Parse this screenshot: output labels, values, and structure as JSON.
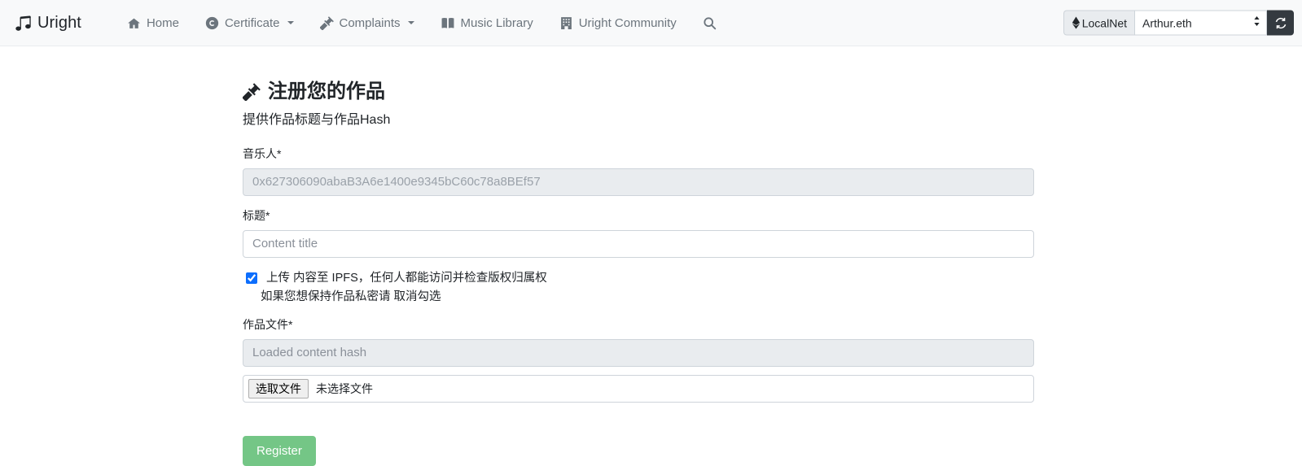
{
  "navbar": {
    "brand": {
      "label": "Uright",
      "icon": "music-note-icon"
    },
    "items": [
      {
        "label": "Home",
        "icon": "home-icon",
        "has_caret": false
      },
      {
        "label": "Certificate",
        "icon": "copyright-icon",
        "has_caret": true
      },
      {
        "label": "Complaints",
        "icon": "gavel-icon",
        "has_caret": true
      },
      {
        "label": "Music Library",
        "icon": "book-icon",
        "has_caret": false
      },
      {
        "label": "Uright Community",
        "icon": "building-icon",
        "has_caret": false
      }
    ],
    "search_icon": "search-icon",
    "network": {
      "badge_label": "LocalNet",
      "badge_icon": "ethereum-icon",
      "account_selected": "Arthur.eth",
      "account_options": [
        "Arthur.eth"
      ],
      "refresh_icon": "refresh-icon"
    }
  },
  "main": {
    "title": "注册您的作品",
    "title_icon": "gavel-icon",
    "subtitle": "提供作品标题与作品Hash",
    "fields": {
      "musician": {
        "label": "音乐人*",
        "value": "0x627306090abaB3A6e1400e9345bC60c78a8BEf57",
        "disabled": true
      },
      "title": {
        "label": "标题*",
        "value": "",
        "placeholder": "Content title"
      },
      "content_file": {
        "label": "作品文件*",
        "value": "",
        "placeholder": "Loaded content hash",
        "disabled": true
      },
      "file_picker": {
        "button_label": "选取文件",
        "status_text": "未选择文件"
      }
    },
    "ipfs_checkbox": {
      "checked": true,
      "line1": "上传 内容至 IPFS，任何人都能访问并检查版权归属权",
      "line2": "如果您想保持作品私密请 取消勾选"
    },
    "submit_label": "Register"
  },
  "colors": {
    "navbar_bg": "#f8f9fa",
    "accent_green": "#74c686",
    "checkbox_blue": "#0d6efd",
    "dark_button": "#343a40",
    "muted_text": "#6c757d",
    "disabled_bg": "#e9ecef"
  }
}
